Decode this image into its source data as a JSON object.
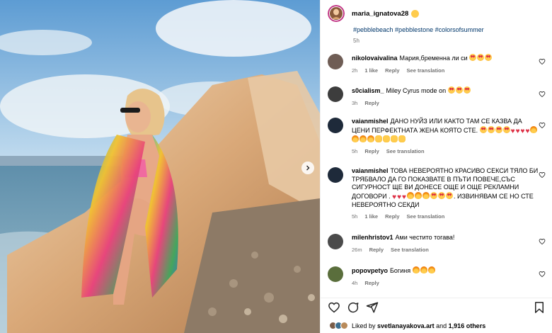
{
  "post": {
    "username": "maria_ignatova28",
    "hashtags": "#pebblebeach #pebblestone #colorsofsummer",
    "time": "5h"
  },
  "comments": [
    {
      "user": "nikolovaivalina",
      "text": "Мария,бременна ли си",
      "emoji": [
        "heart-eyes",
        "heart-eyes",
        "heart-eyes"
      ],
      "time": "2h",
      "likes": "1 like",
      "reply": "Reply",
      "translate": "See translation"
    },
    {
      "user": "s0cialism_",
      "text": "Miley Cyrus mode on",
      "emoji": [
        "heart-eyes",
        "heart-eyes",
        "heart-eyes"
      ],
      "time": "3h",
      "likes": "",
      "reply": "Reply",
      "translate": ""
    },
    {
      "user": "vaianmishel",
      "text": "ДАНО НУЙЗ ИЛИ КАКТО ТАМ СЕ КАЗВА ДА ЦЕНИ ПЕРФЕКТНАТА ЖЕНА КОЯТО СТЕ.",
      "emoji": [
        "heart-eyes",
        "heart-eyes",
        "heart-eyes",
        "heart-eyes",
        "heart",
        "heart",
        "heart",
        "heart",
        "fire",
        "fire",
        "fire",
        "fire",
        "clap",
        "clap",
        "clap",
        "clap"
      ],
      "time": "5h",
      "likes": "",
      "reply": "Reply",
      "translate": "See translation"
    },
    {
      "user": "vaianmishel",
      "text": "ТОВА НЕВЕРОЯТНО КРАСИВО СЕКСИ ТЯЛО БИ ТРЯБВАЛО ДА ГО ПОКАЗВАТЕ В ПЪТИ ПОВЕЧЕ,СЪС СИГУРНОСТ ЩЕ ВИ ДОНЕСЕ ОЩЕ И ОЩЕ РЕКЛАМНИ ДОГОВОРИ .",
      "text2": ". ИЗВИНЯВАМ СЕ НО СТЕ НЕВЕРОЯТНО СЕКДИ",
      "emoji": [
        "heart",
        "heart",
        "heart",
        "fire",
        "fire",
        "fire",
        "heart-eyes",
        "heart-eyes",
        "heart-eyes"
      ],
      "time": "5h",
      "likes": "1 like",
      "reply": "Reply",
      "translate": "See translation"
    },
    {
      "user": "milenhristov1",
      "text": "Ами честито тогава!",
      "emoji": [],
      "time": "26m",
      "likes": "",
      "reply": "Reply",
      "translate": "See translation"
    },
    {
      "user": "popovpetyo",
      "text": "Богиня",
      "emoji": [
        "fire",
        "fire",
        "fire"
      ],
      "time": "4h",
      "likes": "",
      "reply": "Reply",
      "translate": ""
    }
  ],
  "likes": {
    "prefix": "Liked by",
    "user": "svetlanayakova.art",
    "and": "and",
    "others": "1,916 others"
  },
  "colors": {
    "link": "#00376b",
    "meta": "#737373",
    "heart": "#dd2e44"
  },
  "icons": [
    "heart-icon",
    "comment-icon",
    "share-icon",
    "bookmark-icon",
    "chevron-right-icon"
  ]
}
